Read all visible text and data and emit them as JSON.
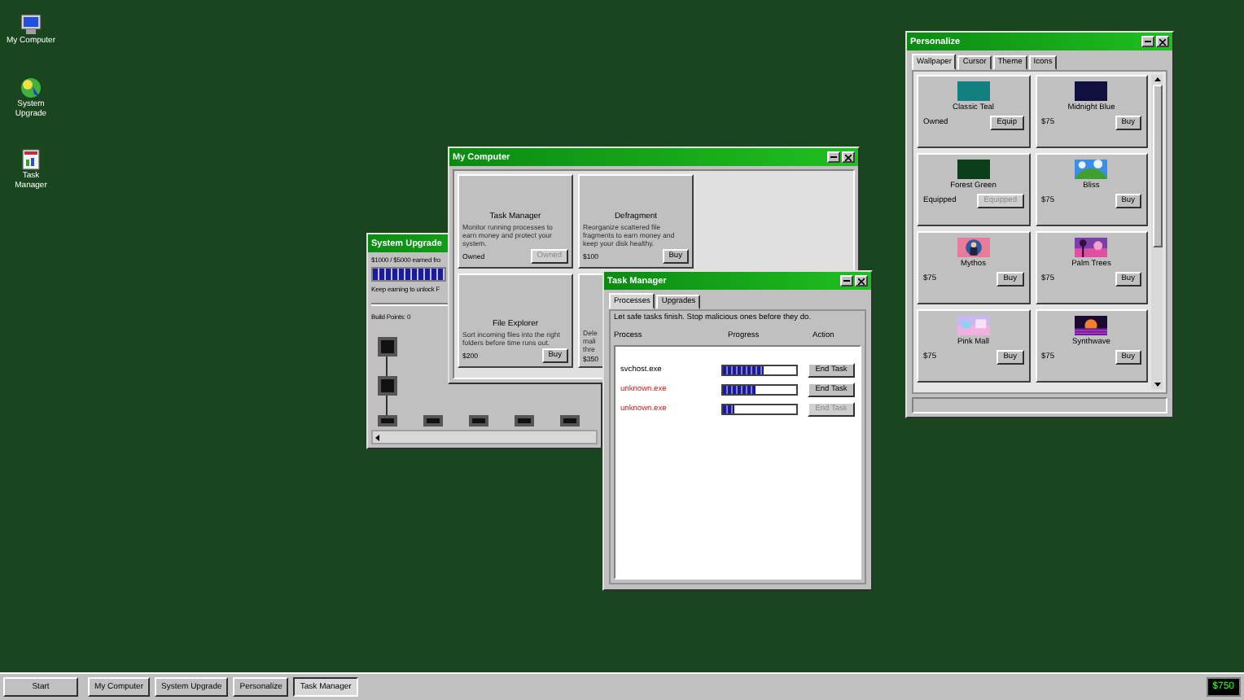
{
  "desktop_icons": [
    {
      "label": "My Computer",
      "kind": "computer"
    },
    {
      "label": "System Upgrade",
      "kind": "upgrade"
    },
    {
      "label": "Task Manager",
      "kind": "taskmgr"
    }
  ],
  "system_upgrade": {
    "title": "System Upgrade",
    "earned": "$1000 / $5000 earned fro",
    "level": 1,
    "hint": "Keep earning to unlock F",
    "build_points": "Build Points: 0"
  },
  "my_computer": {
    "title": "My Computer",
    "cards": [
      {
        "name": "Task Manager",
        "description": "Monitor running processes to earn money and protect your system.",
        "status": "Owned",
        "button": "Owned",
        "disabled": true
      },
      {
        "name": "Defragment",
        "description": "Reorganize scattered file fragments to earn money and keep your disk healthy.",
        "status": "$100",
        "button": "Buy",
        "disabled": false
      },
      {
        "name": "File Explorer",
        "description": "Sort incoming files into the right folders before time runs out.",
        "status": "$200",
        "button": "Buy",
        "disabled": false
      },
      {
        "description": "Dele\nmali\nthre",
        "status": "$350"
      }
    ]
  },
  "task_manager": {
    "title": "Task Manager",
    "tabs": [
      {
        "label": "Processes",
        "selected": true
      },
      {
        "label": "Upgrades",
        "selected": false
      }
    ],
    "instructions": "Let safe tasks finish. Stop malicious ones before they do.",
    "columns": [
      "Process",
      "Progress",
      "Action"
    ],
    "processes": [
      {
        "name": "svchost.exe",
        "malicious": false,
        "level": 0.55,
        "button": "End Task",
        "disabled": false
      },
      {
        "name": "unknown.exe",
        "malicious": true,
        "level": 0.45,
        "button": "End Task",
        "disabled": false
      },
      {
        "name": "unknown.exe",
        "malicious": true,
        "level": 0.15,
        "button": "End Task",
        "disabled": true
      }
    ]
  },
  "personalize": {
    "title": "Personalize",
    "tabs": [
      {
        "label": "Wallpaper",
        "selected": true
      },
      {
        "label": "Cursor",
        "selected": false
      },
      {
        "label": "Theme",
        "selected": false
      },
      {
        "label": "Icons",
        "selected": false
      }
    ],
    "wallpapers": [
      {
        "name": "Classic Teal",
        "kind": "swatch",
        "color": "#138080",
        "status": "Owned",
        "button": "Equip",
        "disabled": false
      },
      {
        "name": "Midnight Blue",
        "kind": "swatch",
        "color": "#101040",
        "status": "$75",
        "button": "Buy",
        "disabled": false
      },
      {
        "name": "Forest Green",
        "kind": "swatch",
        "color": "#0c3d1a",
        "status": "Equipped",
        "button": "Equipped",
        "disabled": true
      },
      {
        "name": "Bliss",
        "kind": "picture",
        "status": "$75",
        "button": "Buy",
        "disabled": false
      },
      {
        "name": "Mythos",
        "kind": "picture",
        "status": "$75",
        "button": "Buy",
        "disabled": false
      },
      {
        "name": "Palm Trees",
        "kind": "picture",
        "status": "$75",
        "button": "Buy",
        "disabled": false
      },
      {
        "name": "Pink Mall",
        "kind": "picture",
        "status": "$75",
        "button": "Buy",
        "disabled": false
      },
      {
        "name": "Synthwave",
        "kind": "picture",
        "status": "$75",
        "button": "Buy",
        "disabled": false
      }
    ]
  },
  "taskbar": {
    "start": "Start",
    "items": [
      {
        "label": "My Computer",
        "selected": false
      },
      {
        "label": "System Upgrade",
        "selected": false
      },
      {
        "label": "Personalize",
        "selected": false
      },
      {
        "label": "Task Manager",
        "selected": true
      }
    ],
    "money": "$750"
  }
}
